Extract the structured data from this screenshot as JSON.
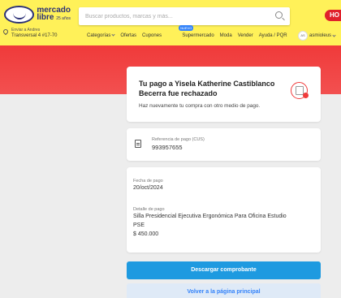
{
  "header": {
    "logo_text": "mercado",
    "logo_text2": "libre",
    "logo_sub": "25 años",
    "search_placeholder": "Buscar productos, marcas y más...",
    "location_line1": "Enviar a Andres",
    "location_line2": "Transversal 4 #17-70",
    "nav": [
      "Categorías",
      "Ofertas",
      "Cupones",
      "Supermercado",
      "Moda",
      "Vender",
      "Ayuda / PQR"
    ],
    "nav_badge": "NUEVO",
    "promo_label": "HO",
    "user_initials": "AS",
    "user_name": "asmioleus"
  },
  "status": {
    "title": "Tu pago a Yisela Katherine Castiblanco Becerra fue rechazado",
    "subtitle": "Haz nuevamente tu compra con otro medio de pago."
  },
  "reference": {
    "label": "Referencia de pago (CUS)",
    "value": "993957655"
  },
  "details": {
    "date_label": "Fecha de pago",
    "date_value": "20/oct/2024",
    "detail_label": "Detalle de pago",
    "product": "Silla Presidencial Ejecutiva Ergonómica Para Oficina Estudio",
    "method": "PSE",
    "amount": "$ 450.000"
  },
  "actions": {
    "download": "Descargar comprobante",
    "home": "Volver a la página principal"
  },
  "colors": {
    "header_yellow": "#fff159",
    "brand_navy": "#2d3277",
    "error_red": "#f03a3a",
    "primary_blue": "#1e9ae0"
  }
}
